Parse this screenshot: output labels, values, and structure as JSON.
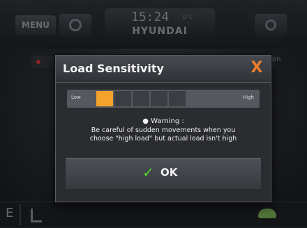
{
  "topbar": {
    "menu_label": "MENU",
    "time": "15:24",
    "temperature": "0°C",
    "brand": "HYUNDAI"
  },
  "background": {
    "partial_text": "on"
  },
  "bottombar": {
    "left_label": "E"
  },
  "dialog": {
    "title": "Load Sensitivity",
    "close_label": "X",
    "slider": {
      "low_label": "Low",
      "high_label": "High",
      "level": 1,
      "steps": 6
    },
    "warning_title": "● Warning :",
    "warning_line1": "Be careful of sudden movements when you",
    "warning_line2": "choose \"high load\" but actual load isn't high",
    "ok_label": "OK"
  },
  "colors": {
    "accent": "#f3a22c",
    "close": "#f07d2a",
    "ok_check": "#55d12d"
  }
}
